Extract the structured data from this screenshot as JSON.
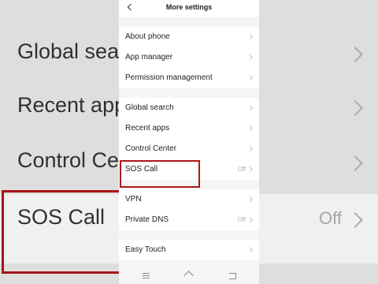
{
  "background": {
    "rows": [
      {
        "label": "Global search",
        "top": 0
      },
      {
        "label": "Recent apps",
        "top": 0
      },
      {
        "label": "Control Center",
        "top": 0
      },
      {
        "label": "SOS Call",
        "value": "Off"
      }
    ]
  },
  "header": {
    "title": "More settings"
  },
  "groups": {
    "g1": [
      "About phone",
      "App manager",
      "Permission management"
    ],
    "g2": [
      "Global search",
      "Recent apps",
      "Control Center"
    ],
    "g3": {
      "sos_label": "SOS Call",
      "sos_value": "Off"
    },
    "g4": {
      "vpn_label": "VPN",
      "dns_label": "Private DNS",
      "dns_value": "Off"
    },
    "g5": [
      "Easy Touch"
    ]
  },
  "colors": {
    "highlight_box": "#b01818"
  }
}
